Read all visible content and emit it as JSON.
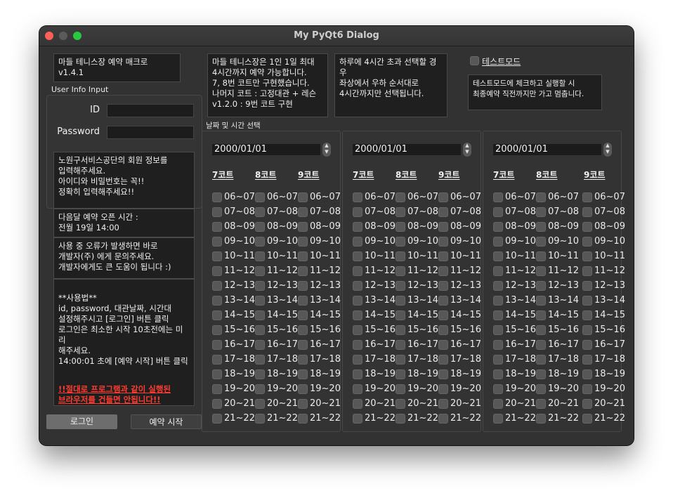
{
  "window": {
    "title": "My PyQt6 Dialog"
  },
  "app_info": {
    "text": "마들 테니스장 예약 매크로\nv1.4.1"
  },
  "rules_info": {
    "text": "마들 테니스장은 1인 1일 최대\n4시간까지 예약 가능합니다.\n7, 8번 코트만 구현했습니다.\n나머지 코트 : 고정대관 + 레슨\nv1.2.0 : 9번 코트 구현"
  },
  "select_info": {
    "text": "하루에 4시간 초과 선택할 경우\n좌상에서 우하 순서대로\n4시간까지만 선택됩니다."
  },
  "test_mode": {
    "label": "테스트모드",
    "desc": "테스트모드에 체크하고 실행할 시\n최종예약 직전까지만 가고 멈춥니다."
  },
  "user_info": {
    "group_label": "User Info Input",
    "id_label": "ID",
    "id_value": "",
    "password_label": "Password",
    "password_value": ""
  },
  "notes": {
    "member": "노원구서비스공단의 회원 정보를\n입력해주세요.\n아이디와 비밀번호는 꼭!!\n정확히 입력해주세요!!",
    "open_time": "다음달 예약 오픈 시간 :\n전월 19일 14:00",
    "error": "사용 중 오류가 발생하면 바로\n개발자(주) 에게 문의주세요.\n개발자에게도 큰 도움이 됩니다 :)",
    "usage": "**사용법**\nid, password, 대관날짜, 시간대\n설정해주시고 [로그인] 버튼 클릭\n로그인은 최소한 시작 10초전에는 미리\n해주세요.\n14:00:01 초에 [예약 시작] 버튼 클릭",
    "warning": "!!절대로 프로그램과 같이 실행된\n브라우저를 건들면 안됩니다!!"
  },
  "colors": {
    "warning": "#ff3b30",
    "window_bg": "#323232"
  },
  "buttons": {
    "login": "로그인",
    "start": "예약 시작"
  },
  "schedule": {
    "label": "날짜 및 시간 선택",
    "courts": [
      "7코트",
      "8코트",
      "9코트"
    ],
    "slots": [
      "06~07",
      "07~08",
      "08~09",
      "09~10",
      "10~11",
      "11~12",
      "12~13",
      "13~14",
      "14~15",
      "15~16",
      "16~17",
      "17~18",
      "18~19",
      "19~20",
      "20~21",
      "21~22"
    ],
    "panels": [
      {
        "date": "2000/01/01"
      },
      {
        "date": "2000/01/01"
      },
      {
        "date": "2000/01/01"
      }
    ]
  }
}
